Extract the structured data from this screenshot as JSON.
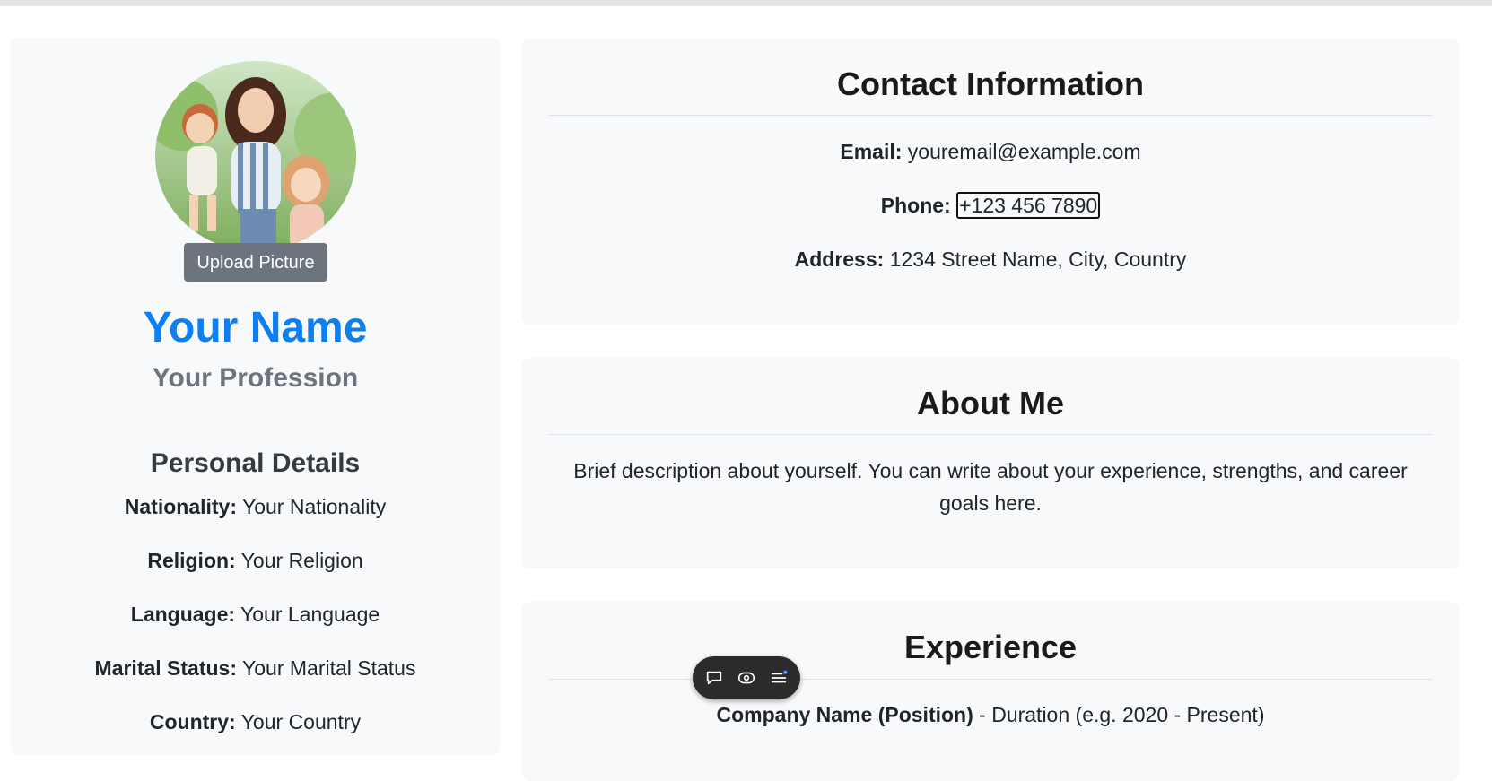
{
  "profile": {
    "upload_label": "Upload Picture",
    "name": "Your Name",
    "profession": "Your Profession"
  },
  "personal_details": {
    "title": "Personal Details",
    "items": [
      {
        "label": "Nationality:",
        "value": "Your Nationality"
      },
      {
        "label": "Religion:",
        "value": "Your Religion"
      },
      {
        "label": "Language:",
        "value": "Your Language"
      },
      {
        "label": "Marital Status:",
        "value": "Your Marital Status"
      },
      {
        "label": "Country:",
        "value": "Your Country"
      }
    ]
  },
  "contact": {
    "title": "Contact Information",
    "email_label": "Email:",
    "email": "youremail@example.com",
    "phone_label": "Phone:",
    "phone": "+123 456 7890",
    "address_label": "Address:",
    "address": "1234 Street Name, City, Country"
  },
  "about": {
    "title": "About Me",
    "text": "Brief description about yourself. You can write about your experience, strengths, and career goals here."
  },
  "experience": {
    "title": "Experience",
    "entries": [
      {
        "company": "Company Name (Position)",
        "duration": " - Duration (e.g. 2020 - Present)"
      }
    ]
  },
  "toolbar": {
    "icons": [
      "chat-bubble-icon",
      "eye-icon",
      "menu-list-icon"
    ]
  },
  "colors": {
    "accent": "#0d7ff2",
    "muted": "#6c757d",
    "card_bg": "#f8f9fa"
  }
}
